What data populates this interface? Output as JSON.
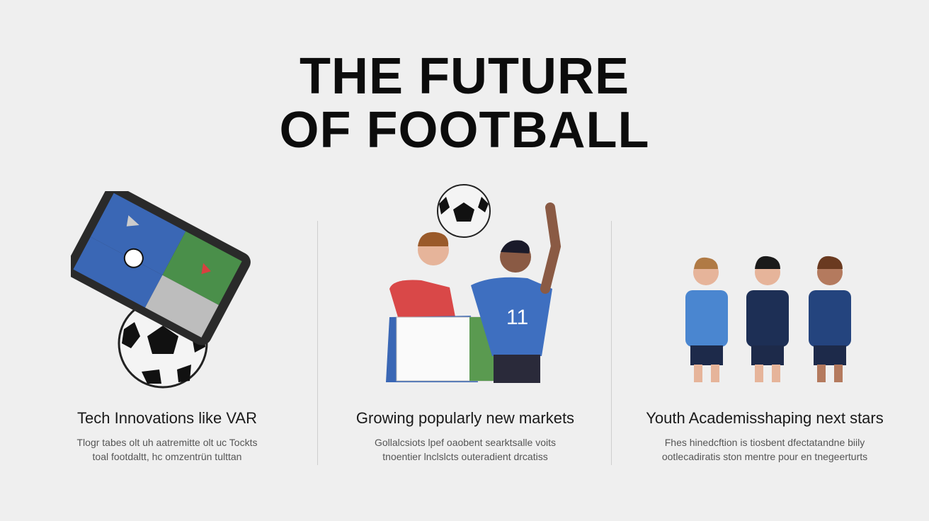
{
  "title": {
    "line1": "THE FUTURE",
    "line2": "OF FOOTBALL"
  },
  "columns": [
    {
      "heading": "Tech Innovations like VAR",
      "desc1": "Tlogr tabes olt uh aatremitte olt uc Tockts",
      "desc2": "toal footdaltt, hc omzentrün tulttan"
    },
    {
      "heading": "Growing popularly new markets",
      "desc1": "Gollalcsiots lpef oaobent searktsalle voits",
      "desc2": "tnoentier lnclslcts outeradient drcatiss",
      "jersey_number": "11"
    },
    {
      "heading": "Youth Academisshaping next stars",
      "desc1": "Fhes hinedcftion is tiosbent dfectatandne biily",
      "desc2": "ootlecadiratis ston mentre pour en tnegeerturts"
    }
  ]
}
